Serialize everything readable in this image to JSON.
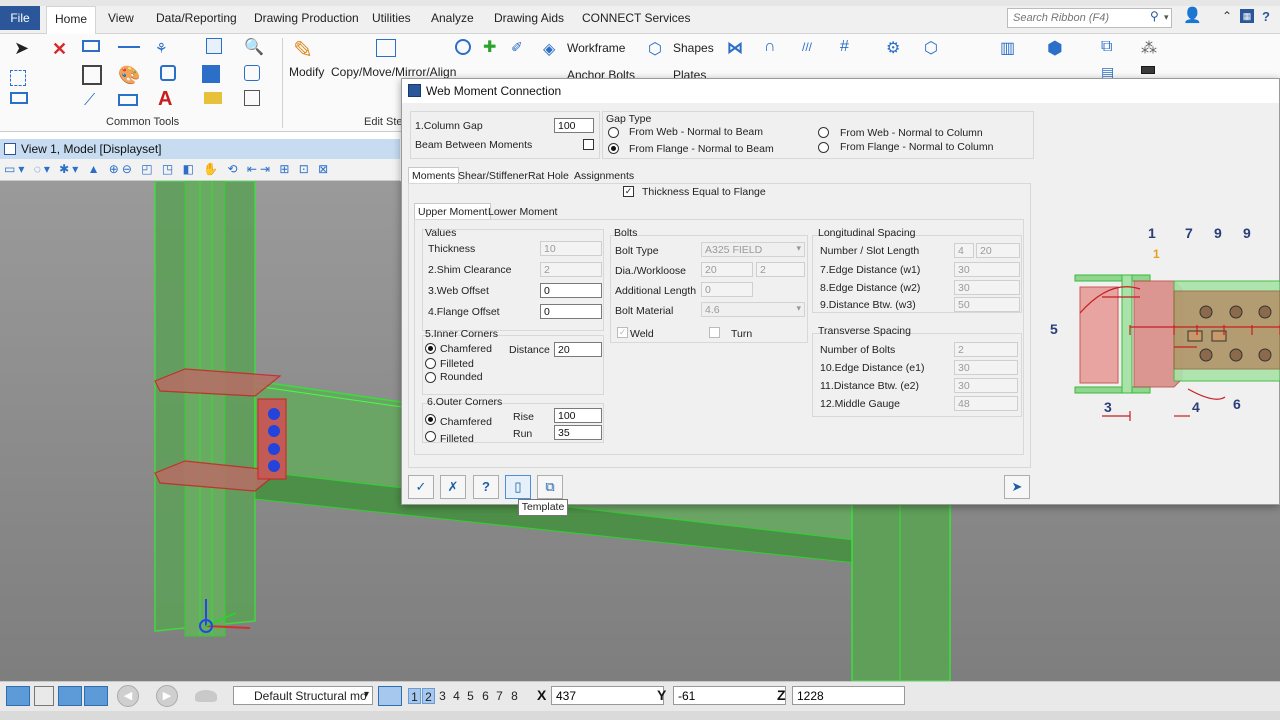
{
  "ribbon": {
    "tabs": [
      "File",
      "Home",
      "View",
      "Data/Reporting",
      "Drawing Production",
      "Utilities",
      "Analyze",
      "Drawing Aids",
      "CONNECT Services"
    ],
    "search_placeholder": "Search Ribbon (F4)",
    "groups": {
      "common_tools": "Common Tools",
      "edit": "Edit Ste",
      "modify": "Modify",
      "copy_move": "Copy/Move/Mirror/Align",
      "workframe": "Workframe",
      "anchor_bolts": "Anchor Bolts",
      "shapes": "Shapes",
      "plates": "Plates"
    }
  },
  "view": {
    "title": "View 1, Model [Displayset]"
  },
  "status": {
    "model": "Default Structural mo",
    "view_numbers": [
      "1",
      "2",
      "3",
      "4",
      "5",
      "6",
      "7",
      "8"
    ],
    "x_label": "X",
    "x_value": "437",
    "y_label": "Y",
    "y_value": "-61",
    "z_label": "Z",
    "z_value": "1228"
  },
  "dialog": {
    "title": "Web Moment Connection",
    "column_gap_label": "1.Column Gap",
    "column_gap_value": "100",
    "beam_between_label": "Beam Between Moments",
    "gap_type": {
      "legend": "Gap Type",
      "options": [
        "From Web - Normal to Beam",
        "From Flange - Normal to Beam",
        "From Web - Normal to Column",
        "From Flange - Normal to Column"
      ],
      "selected": "From Flange - Normal to Beam"
    },
    "tabs": [
      "Moments",
      "Shear/Stiffener",
      "Rat Hole",
      "Assignments"
    ],
    "thickness_equal": "Thickness Equal to Flange",
    "subtabs": [
      "Upper Moment",
      "Lower Moment"
    ],
    "values": {
      "legend": "Values",
      "thickness_label": "Thickness",
      "thickness_value": "10",
      "shim_label": "2.Shim Clearance",
      "shim_value": "2",
      "web_offset_label": "3.Web Offset",
      "web_offset_value": "0",
      "flange_offset_label": "4.Flange Offset",
      "flange_offset_value": "0"
    },
    "inner_corners": {
      "legend": "5.Inner Corners",
      "options": [
        "Chamfered",
        "Filleted",
        "Rounded"
      ],
      "selected": "Chamfered",
      "distance_label": "Distance",
      "distance_value": "20"
    },
    "outer_corners": {
      "legend": "6.Outer Corners",
      "options": [
        "Chamfered",
        "Filleted"
      ],
      "selected": "Chamfered",
      "rise_label": "Rise",
      "rise_value": "100",
      "run_label": "Run",
      "run_value": "35"
    },
    "bolts": {
      "legend": "Bolts",
      "type_label": "Bolt Type",
      "type_value": "A325 FIELD",
      "dia_label": "Dia./Workloose",
      "dia_value": "20",
      "workloose_value": "2",
      "addl_label": "Additional Length",
      "addl_value": "0",
      "material_label": "Bolt Material",
      "material_value": "4.6",
      "weld_label": "Weld",
      "turn_label": "Turn"
    },
    "longitudinal": {
      "legend": "Longitudinal Spacing",
      "number_label": "Number / Slot Length",
      "number_value": "4",
      "slot_value": "20",
      "edge_w1_label": "7.Edge Distance (w1)",
      "edge_w1_value": "30",
      "edge_w2_label": "8.Edge Distance (w2)",
      "edge_w2_value": "30",
      "dist_w3_label": "9.Distance Btw. (w3)",
      "dist_w3_value": "50"
    },
    "transverse": {
      "legend": "Transverse Spacing",
      "num_bolts_label": "Number of Bolts",
      "num_bolts_value": "2",
      "edge_e1_label": "10.Edge Distance (e1)",
      "edge_e1_value": "30",
      "dist_e2_label": "11.Distance Btw. (e2)",
      "dist_e2_value": "30",
      "middle_gauge_label": "12.Middle Gauge",
      "middle_gauge_value": "48"
    },
    "tooltip": "Template",
    "diagram_labels": [
      "1",
      "7",
      "9",
      "9",
      "1",
      "5",
      "3",
      "4",
      "6"
    ]
  }
}
